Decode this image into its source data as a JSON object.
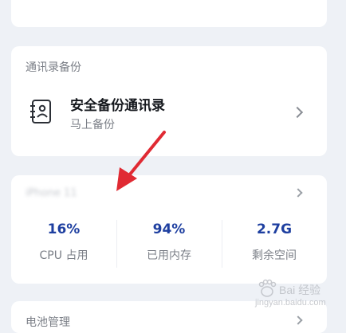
{
  "contacts_card": {
    "section_title": "通讯录备份",
    "item_title": "安全备份通讯录",
    "item_subtitle": "马上备份",
    "icon": "contacts-book-icon"
  },
  "device_card": {
    "device_name": "iPhone 11",
    "stats": [
      {
        "value": "16%",
        "label": "CPU 占用"
      },
      {
        "value": "94%",
        "label": "已用内存"
      },
      {
        "value": "2.7G",
        "label": "剩余空间"
      }
    ],
    "accent_color": "#1e3fa0"
  },
  "battery_card": {
    "section_title": "电池管理"
  },
  "annotation": {
    "arrow_color": "#e02a33"
  },
  "watermark": {
    "main": "Bai 经验",
    "sub": "jingyan.baidu.com"
  }
}
